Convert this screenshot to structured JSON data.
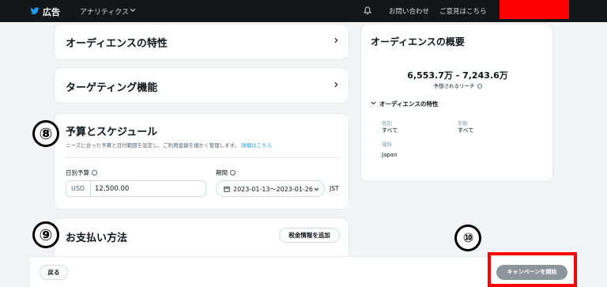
{
  "topbar": {
    "title": "広告",
    "menu": "アナリティクス",
    "link_contact": "お問い合わせ",
    "link_feedback": "ご意見はこちら",
    "redacted_color": "#ff0000"
  },
  "main": {
    "audience_traits": {
      "title": "オーディエンスの特性"
    },
    "targeting": {
      "title": "ターゲティング機能"
    },
    "budget": {
      "title": "予算とスケジュール",
      "subtitle": "ニーズに合った予算と日付範囲を設定し、ご利用金額を細かく管理します。",
      "subtitle_link": "詳細はこちら",
      "daily_budget_label": "日別予算",
      "currency": "USD",
      "daily_budget_value": "12,500.00",
      "period_label": "期間",
      "period_value": "2023-01-13〜2023-01-26",
      "timezone": "JST"
    },
    "payment": {
      "title": "お支払い方法",
      "tax_button": "税金情報を追加"
    }
  },
  "summary": {
    "title": "オーディエンスの概要",
    "reach_value": "6,553.7万 - 7,243.6万",
    "reach_label": "予想されるリーチ",
    "section_title": "オーディエンスの特性",
    "gender_label": "性別",
    "gender_value": "すべて",
    "age_label": "年齢",
    "age_value": "すべて",
    "location_label": "場所",
    "location_value": "Japan"
  },
  "footer": {
    "back_button": "戻る",
    "start_button": "キャンペーンを開始"
  },
  "annotations": {
    "marker_8": "⑧",
    "marker_9": "⑨",
    "marker_10": "⑩"
  }
}
